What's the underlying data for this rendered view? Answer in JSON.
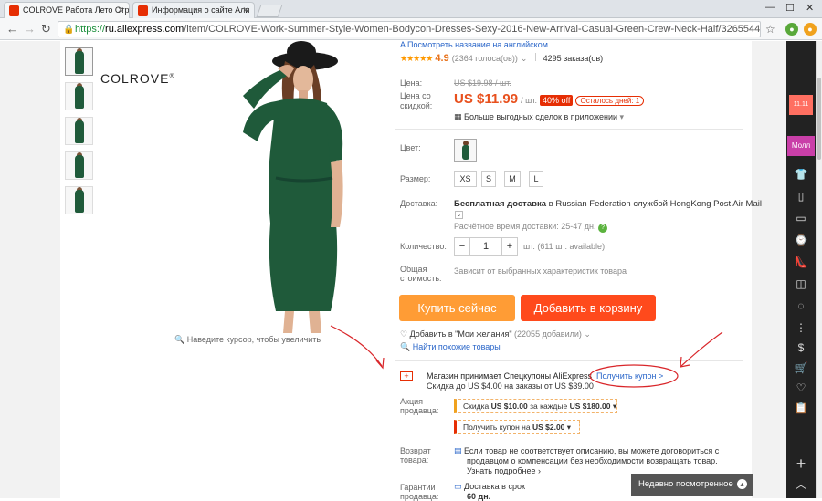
{
  "browser": {
    "tabs": [
      {
        "title": "COLROVE Работа Лето Стр",
        "active": true
      },
      {
        "title": "Информация о сайте Али",
        "active": false
      }
    ],
    "url_https": "https://",
    "url_domain": "ru.aliexpress.com",
    "url_path": "/item/COLROVE-Work-Summer-Style-Women-Bodycon-Dresses-Sexy-2016-New-Arrival-Casual-Green-Crew-Neck-Half/32655446818.html?spm="
  },
  "gallery": {
    "brand": "COLROVE",
    "brand_mark": "®",
    "zoom_hint": "Наведите курсор, чтобы увеличить"
  },
  "product": {
    "show_english": "Посмотреть название на английском",
    "stars": "★★★★★",
    "rating": "4.9",
    "votes": "(2364 голоса(ов))",
    "orders": "4295 заказа(ов)",
    "price_label": "Цена:",
    "old_price": "US $19.98 / шт.",
    "discount_price_label": "Цена со скидкой:",
    "price": "US $11.99",
    "price_unit": "/ шт.",
    "off_badge": "40% off",
    "left_badge": "Осталось дней: 1",
    "app_deals": "Больше выгодных сделок в приложении",
    "color_label": "Цвет:",
    "size_label": "Размер:",
    "sizes": [
      "XS",
      "S",
      "M",
      "L"
    ],
    "shipping_label": "Доставка:",
    "shipping_free": "Бесплатная доставка",
    "shipping_in": "в Russian Federation службой HongKong Post Air Mail",
    "delivery_time": "Расчётное время доставки: 25-47 дн.",
    "qty_label": "Количество:",
    "qty_minus": "−",
    "qty_value": "1",
    "qty_plus": "+",
    "qty_unit": "шт. (611 шт. available)",
    "total_label_1": "Общая",
    "total_label_2": "стоимость:",
    "total_value": "Зависит от выбранных характеристик товара",
    "buy_now": "Купить сейчас",
    "add_cart": "Добавить в корзину",
    "wishlist": "Добавить в \"Мои желания\"",
    "wishlist_count": "(22055 добавили)",
    "similar": "Найти похожие товары"
  },
  "coupons": {
    "title": "Магазин принимает Спецкупоны AliExpress",
    "get_coupon": "Получить купон >",
    "subtitle": "Скидка до US $4.00 на заказы от US $39.00",
    "promo_label_1": "Акция",
    "promo_label_2": "продавца:",
    "promo1_prefix": "Скидка",
    "promo1_amount": "US $10.00",
    "promo1_mid": "за каждые",
    "promo1_threshold": "US $180.00",
    "promo2_prefix": "Получить купон на",
    "promo2_amount": "US $2.00"
  },
  "returns": {
    "label_1": "Возврат",
    "label_2": "товара:",
    "line1": "Если товар не соответствует описанию, вы можете договориться с",
    "line2": "продавцом о компенсации без необходимости возвращать товар.",
    "more": "Узнать подробнее",
    "guarantee_1": "Гарантии",
    "guarantee_2": "продавца:",
    "ontime": "Доставка в срок",
    "ontime_days": "60 дн."
  },
  "recent": {
    "label": "Недавно посмотренное"
  },
  "sidebar": {
    "badge": "11.11",
    "mall": "Молл"
  },
  "colors": {
    "accent": "#ff7f1f",
    "cart": "#ff4a1c",
    "sidebar": "#222222",
    "dress": "#1f5a3a",
    "annotation": "#d9262a"
  }
}
